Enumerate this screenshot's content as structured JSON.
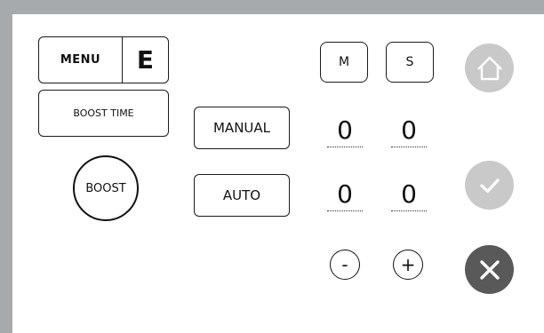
{
  "menu": {
    "label": "MENU",
    "mode_letter": "E"
  },
  "boost_time": {
    "label": "BOOST TIME"
  },
  "boost": {
    "label": "BOOST"
  },
  "modes": {
    "manual_label": "MANUAL",
    "auto_label": "AUTO"
  },
  "time_units": {
    "minutes_label": "M",
    "seconds_label": "S"
  },
  "digits": {
    "row1": [
      "0",
      "0"
    ],
    "row2": [
      "0",
      "0"
    ]
  },
  "steppers": {
    "minus": "-",
    "plus": "+"
  },
  "actions": {
    "home": "home-icon",
    "confirm": "check-icon",
    "cancel": "close-icon"
  },
  "colors": {
    "frame": "#a7aaad",
    "action_light": "#c9c9c9",
    "action_dark": "#595959"
  }
}
